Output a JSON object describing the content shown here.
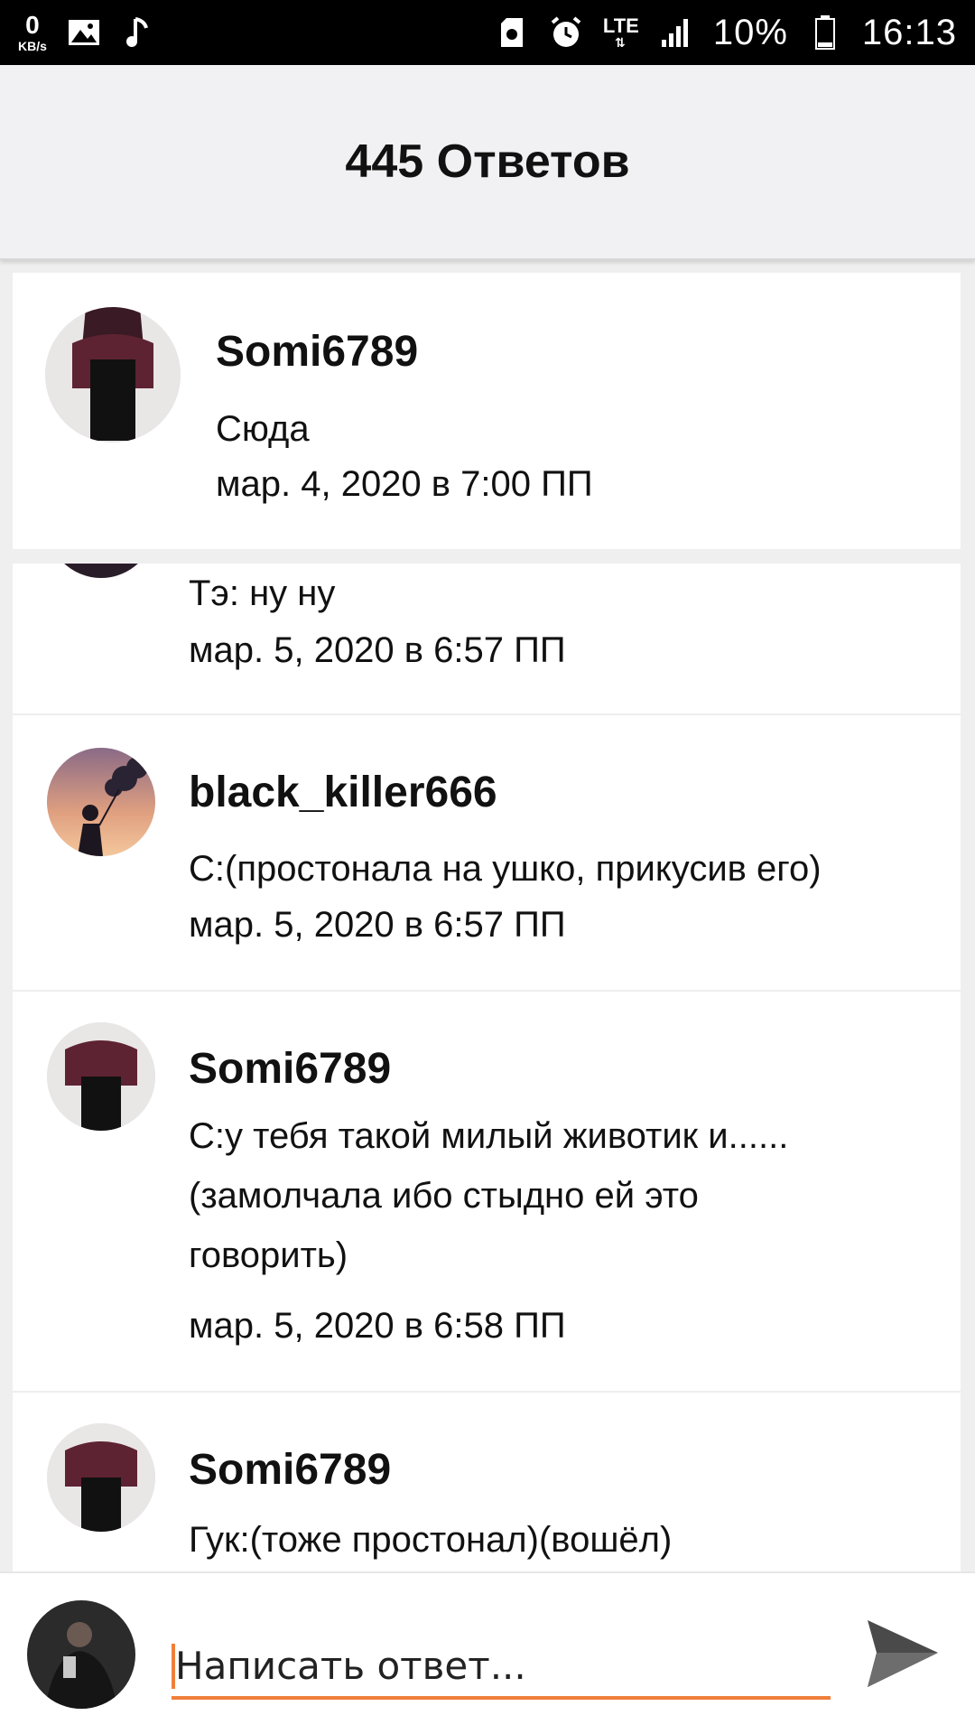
{
  "status_bar": {
    "net_speed_value": "0",
    "net_speed_unit": "KB/s",
    "network": "LTE",
    "battery": "10%",
    "time": "16:13"
  },
  "header": {
    "title": "445 Ответов"
  },
  "replies": [
    {
      "username": "Somi6789",
      "message": "Сюда",
      "date": "мар. 4, 2020 в 7:00 ПП"
    },
    {
      "username": "",
      "message": "Тэ: ну ну",
      "date": "мар. 5, 2020 в 6:57 ПП"
    },
    {
      "username": "black_killer666",
      "message": "С:(простонала на ушко, прикусив его)",
      "date": "мар. 5, 2020 в 6:57 ПП"
    },
    {
      "username": "Somi6789",
      "message_lines": [
        "С:у тебя такой милый животик и......",
        "(замолчала ибо стыдно ей это",
        "говорить)"
      ],
      "date": "мар. 5, 2020 в 6:58 ПП"
    },
    {
      "username": "Somi6789",
      "message": "Гук:(тоже простонал)(вошёл)"
    }
  ],
  "composer": {
    "placeholder": "Написать ответ..."
  },
  "colors": {
    "accent": "#f07f3c",
    "header_bg": "#f1f0f2",
    "page_bg": "#efefef"
  }
}
